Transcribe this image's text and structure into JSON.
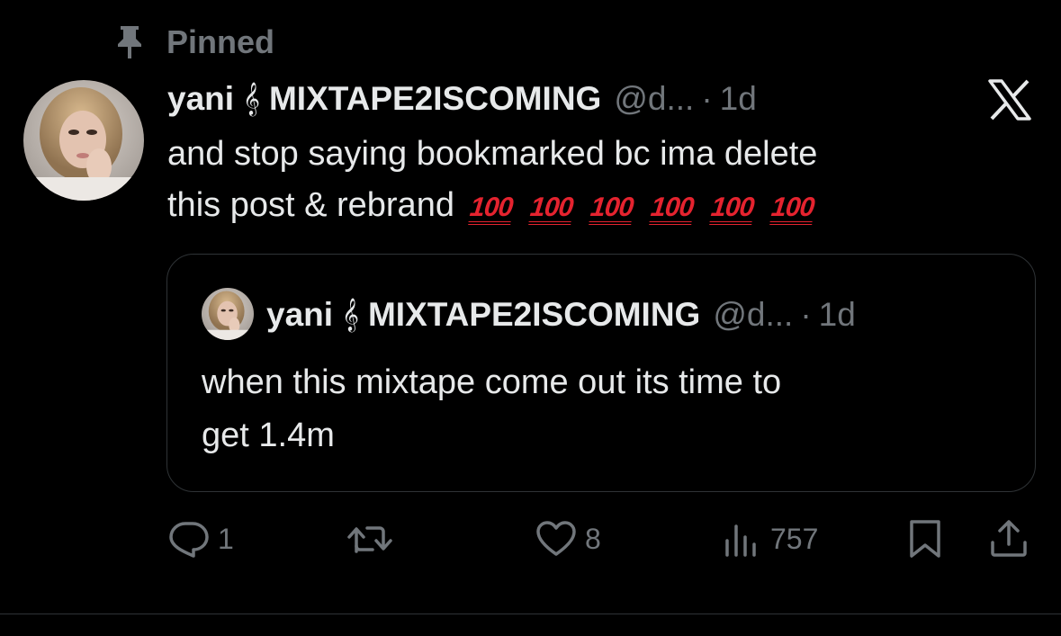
{
  "pinned": {
    "label": "Pinned",
    "icon": "pin-icon"
  },
  "post": {
    "display_name": "yani",
    "clef": "𝄞",
    "name_suffix": "MIXTAPE2ISCOMING",
    "handle": "@d...",
    "separator": "·",
    "time": "1d",
    "text_line1": "and stop saying bookmarked bc ima delete",
    "text_line2": "this post & rebrand",
    "emoji": [
      "💯",
      "💯",
      "💯",
      "💯",
      "💯",
      "💯"
    ],
    "emoji_glyph": "100"
  },
  "quote": {
    "display_name": "yani",
    "clef": "𝄞",
    "name_suffix": "MIXTAPE2ISCOMING",
    "handle": "@d...",
    "separator": "·",
    "time": "1d",
    "text_line1": "when this mixtape come out its time to",
    "text_line2": "get 1.4m"
  },
  "actions": {
    "replies": "1",
    "retweets": "",
    "likes": "8",
    "views": "757"
  },
  "colors": {
    "background": "#000000",
    "text": "#e7e9ea",
    "muted": "#71767b",
    "border": "#2f3336",
    "emoji_red": "#e5232f"
  }
}
